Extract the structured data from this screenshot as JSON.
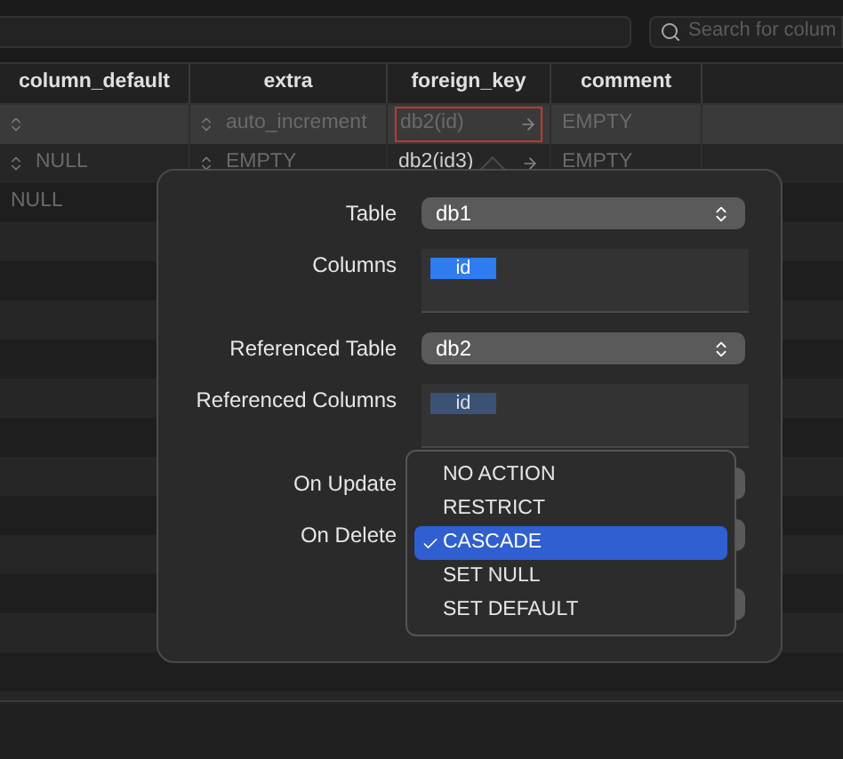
{
  "search": {
    "placeholder": "Search for colum"
  },
  "table": {
    "columns": [
      "column_default",
      "extra",
      "foreign_key",
      "comment"
    ],
    "rows": [
      {
        "selected": true,
        "cells": [
          {
            "stepper": true
          },
          {
            "text": "auto_increment",
            "muted": true,
            "stepper": true
          },
          {
            "text": "db2(id)",
            "muted": true,
            "link": true,
            "outlined": true
          },
          {
            "text": "EMPTY",
            "muted": true
          }
        ]
      },
      {
        "selected": false,
        "cells": [
          {
            "text": "NULL",
            "muted": true,
            "stepper": true
          },
          {
            "text": "EMPTY",
            "muted": true,
            "stepper": true
          },
          {
            "text": "db2(id3)",
            "muted": false,
            "link": true,
            "outlined": false
          },
          {
            "text": "EMPTY",
            "muted": true
          }
        ]
      },
      {
        "selected": false,
        "cells": [
          {
            "text": "NULL",
            "muted": true
          }
        ]
      }
    ]
  },
  "popover": {
    "fields": [
      {
        "kind": "select",
        "label": "Table",
        "value": "db1"
      },
      {
        "kind": "list",
        "label": "Columns",
        "focused": true,
        "items": [
          {
            "text": "id",
            "selected": true
          }
        ]
      },
      {
        "kind": "select",
        "label": "Referenced Table",
        "value": "db2"
      },
      {
        "kind": "list",
        "label": "Referenced Columns",
        "focused": false,
        "items": [
          {
            "text": "id",
            "selected": true
          }
        ]
      },
      {
        "kind": "select",
        "label": "On Update"
      },
      {
        "kind": "select",
        "label": "On Delete"
      },
      {
        "kind": "select"
      }
    ],
    "menu": {
      "items": [
        {
          "text": "NO ACTION",
          "selected": false
        },
        {
          "text": "RESTRICT",
          "selected": false
        },
        {
          "text": "CASCADE",
          "selected": true
        },
        {
          "text": "SET NULL",
          "selected": false
        },
        {
          "text": "SET DEFAULT",
          "selected": false
        }
      ]
    }
  }
}
